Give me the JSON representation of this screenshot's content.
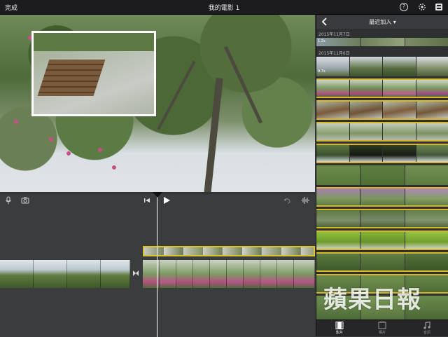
{
  "topbar": {
    "done_label": "完成",
    "title": "我的電影 1",
    "help_glyph": "?"
  },
  "browser": {
    "title": "最近加入 ▾",
    "dates": [
      "2015年11月7日",
      "2015年11月6日"
    ],
    "durations": [
      "1.2s",
      "9.7s"
    ]
  },
  "tabs": [
    {
      "label": "影片",
      "icon": "film-icon",
      "active": true
    },
    {
      "label": "相片",
      "icon": "photo-icon",
      "active": false
    },
    {
      "label": "音訊",
      "icon": "music-note-icon",
      "active": false
    }
  ],
  "watermark": "蘋果日報",
  "colors": {
    "clip_used_border": "#d9b52a",
    "accent_yellow": "#d9c22f",
    "playhead": "#ffffff"
  }
}
